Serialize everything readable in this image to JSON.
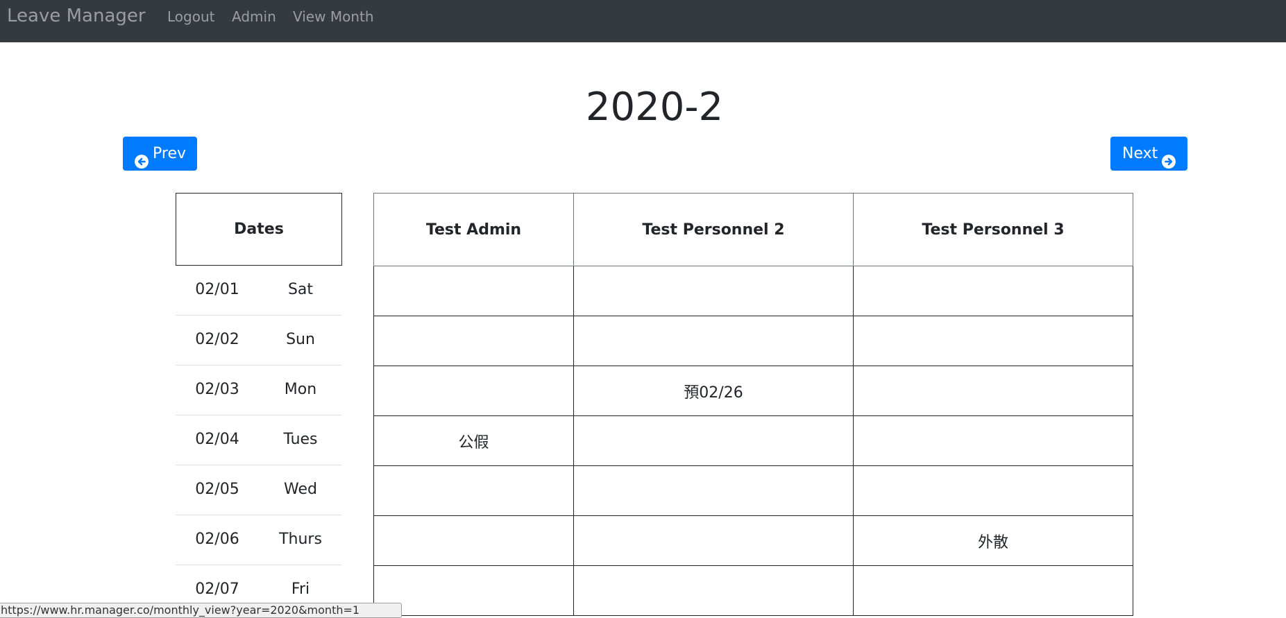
{
  "navbar": {
    "brand": "Leave Manager",
    "links": [
      "Logout",
      "Admin",
      "View Month"
    ]
  },
  "title": "2020-2",
  "buttons": {
    "prev": "Prev",
    "next": "Next",
    "prev_icon": "arrow-circle-left-icon",
    "next_icon": "arrow-circle-right-icon"
  },
  "colors": {
    "navbar": "#343a40",
    "primary": "#007bff"
  },
  "dates": {
    "header": "Dates",
    "rows": [
      {
        "date": "02/01",
        "day": "Sat"
      },
      {
        "date": "02/02",
        "day": "Sun"
      },
      {
        "date": "02/03",
        "day": "Mon"
      },
      {
        "date": "02/04",
        "day": "Tues"
      },
      {
        "date": "02/05",
        "day": "Wed"
      },
      {
        "date": "02/06",
        "day": "Thurs"
      },
      {
        "date": "02/07",
        "day": "Fri"
      }
    ]
  },
  "leave_table": {
    "columns": [
      "Test Admin",
      "Test Personnel 2",
      "Test Personnel 3"
    ],
    "rows": [
      [
        "",
        "",
        ""
      ],
      [
        "",
        "",
        ""
      ],
      [
        "",
        "預02/26",
        ""
      ],
      [
        "公假",
        "",
        ""
      ],
      [
        "",
        "",
        ""
      ],
      [
        "",
        "",
        "外散"
      ],
      [
        "",
        "",
        ""
      ]
    ]
  },
  "status_bar": "https://www.hr.manager.co/monthly_view?year=2020&month=1"
}
